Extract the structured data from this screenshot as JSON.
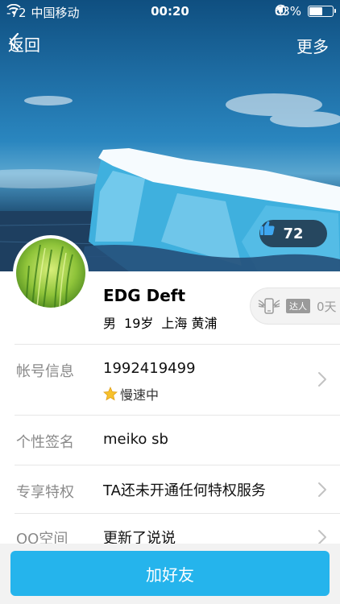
{
  "status_bar": {
    "signal": "-72",
    "carrier": "中国移动",
    "time": "00:20",
    "battery": "63%",
    "battery_level": 0.63
  },
  "nav": {
    "back_label": "返回",
    "more_label": "更多"
  },
  "cover": {
    "likes": "72"
  },
  "profile": {
    "name": "EDG Deft",
    "gender": "男",
    "age": "19岁",
    "location": "上海 黄浦",
    "badge_tag": "达人",
    "badge_days": "0天"
  },
  "rows": [
    {
      "label": "帐号信息",
      "value": "1992419499",
      "sub": "慢速中"
    },
    {
      "label": "个性签名",
      "value": "meiko sb"
    },
    {
      "label": "专享特权",
      "value": "TA还未开通任何特权服务"
    },
    {
      "label": "QQ空间",
      "value": "更新了说说"
    }
  ],
  "action": {
    "add_friend": "加好友"
  },
  "colors": {
    "accent": "#25b4ec",
    "label_gray": "#8a8a8a",
    "badge_gray": "#9a9a9a"
  }
}
